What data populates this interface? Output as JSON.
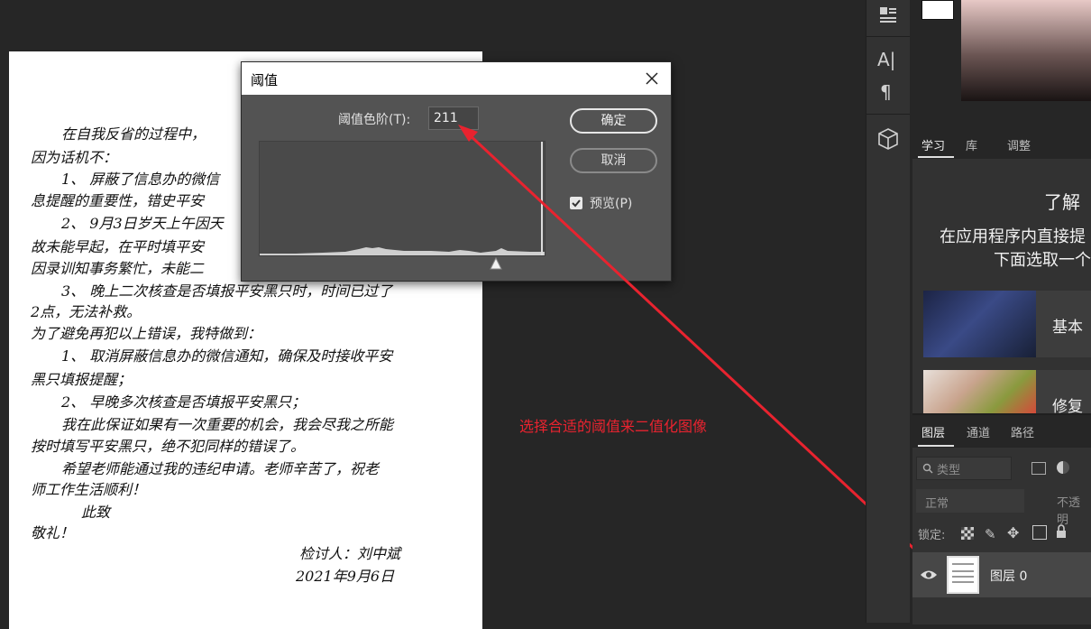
{
  "document": {
    "lines": [
      "在自我反省的过程中，",
      "因为话机不：",
      "1、 屏蔽了信息办的微信",
      "息提醒的重要性，错史平安",
      "2、 9月3日岁天上午因天",
      "故未能早起，在平时填平安",
      "因录训知事务繁忙，未能二",
      "3、 晚上二次核查是否填报平安黑只时，时间已过了",
      "2点，无法补救。",
      "为了避免再犯以上错误，我特做到：",
      "1、 取消屏蔽信息办的微信通知，确保及时接收平安",
      "黑只填报提醒；",
      "2、 早晚多次核查是否填报平安黑只；",
      "我在此保证如果有一次重要的机会，我会尽我之所能",
      "按时填写平安黑只，绝不犯同样的错误了。",
      "希望老师能通过我的违纪申请。老师辛苦了，祝老",
      "师工作生活顺利！",
      "此致",
      "敬礼！"
    ],
    "signature": "检讨人：刘中斌",
    "date": "2021年9月6日"
  },
  "dialog": {
    "title": "阈值",
    "level_label": "阈值色阶(T):",
    "level_value": "211",
    "ok_label": "确定",
    "cancel_label": "取消",
    "preview_label": "预览(P)",
    "preview_checked": true,
    "threshold_level": 211,
    "threshold_max": 255
  },
  "annotation": {
    "text": "选择合适的阈值来二值化图像",
    "color": "#e8232f"
  },
  "learn_panel": {
    "tabs": [
      "学习",
      "库",
      "调整"
    ],
    "title": "了解",
    "subtitle_lines": [
      "在应用程序内直接提",
      "下面选取一个"
    ],
    "cards": [
      {
        "label": "基本"
      },
      {
        "label": "修复"
      }
    ]
  },
  "layers_panel": {
    "tabs": [
      "图层",
      "通道",
      "路径"
    ],
    "search_placeholder": "类型",
    "blend_mode": "正常",
    "opacity_label": "不透明",
    "lock_label": "锁定:",
    "layer_name": "图层 0"
  },
  "colors": {
    "accent_red": "#e8232f",
    "panel_bg": "#323232",
    "workspace_bg": "#262626"
  },
  "icons": [
    "properties-icon",
    "character-icon",
    "paragraph-icon",
    "3d-cube-icon",
    "close-icon",
    "eye-icon",
    "search-icon",
    "lock-icon"
  ]
}
